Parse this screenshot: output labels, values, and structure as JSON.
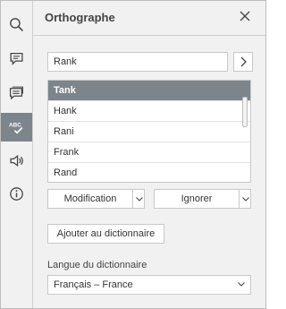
{
  "panel": {
    "title": "Orthographe"
  },
  "rail": {
    "items": [
      {
        "icon": "search-icon"
      },
      {
        "icon": "comment-icon"
      },
      {
        "icon": "chat-icon"
      },
      {
        "icon": "spellcheck-icon",
        "active": true
      },
      {
        "icon": "speaker-icon"
      },
      {
        "icon": "info-icon"
      }
    ]
  },
  "word_field": {
    "value": "Rank"
  },
  "suggestions": [
    "Tank",
    "Hank",
    "Rani",
    "Frank",
    "Rand"
  ],
  "actions": {
    "change_label": "Modification",
    "ignore_label": "Ignorer",
    "add_label": "Ajouter au dictionnaire"
  },
  "language": {
    "label": "Langue du dictionnaire",
    "selected": "Français – France"
  },
  "colors": {
    "selected_bg": "#7d858c",
    "panel_bg": "#f1f1f1"
  }
}
